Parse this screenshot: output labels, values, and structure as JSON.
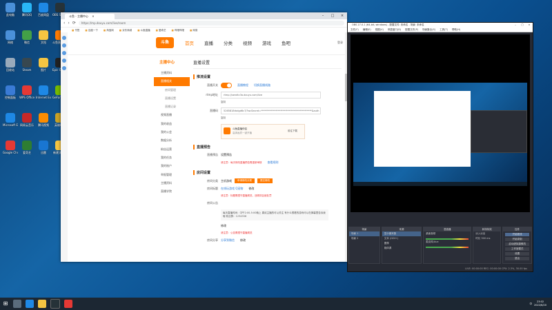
{
  "desktop": {
    "icons": [
      {
        "label": "此电脑",
        "color": "#4a90d9"
      },
      {
        "label": "网络",
        "color": "#4a90d9"
      },
      {
        "label": "回收站",
        "color": "#9ab"
      },
      {
        "label": "控制面板",
        "color": "#3a7bd5"
      },
      {
        "label": "Microsoft Edge",
        "color": "#1e88e5"
      },
      {
        "label": "Google Chrome",
        "color": "#e53935"
      },
      {
        "label": "腾讯QQ",
        "color": "#29b6f6"
      },
      {
        "label": "微信",
        "color": "#43a047"
      },
      {
        "label": "Steam",
        "color": "#37474f"
      },
      {
        "label": "WPS Office",
        "color": "#e53935"
      },
      {
        "label": "网易云音乐",
        "color": "#c62828"
      },
      {
        "label": "爱奇艺",
        "color": "#2e7d32"
      },
      {
        "label": "百度网盘",
        "color": "#1e88e5"
      },
      {
        "label": "文档",
        "color": "#f5c542"
      },
      {
        "label": "图片",
        "color": "#f5c542"
      },
      {
        "label": "Internet Explorer",
        "color": "#1e88e5"
      },
      {
        "label": "腾讯视频",
        "color": "#fb8c00"
      },
      {
        "label": "迅雷",
        "color": "#1976d2"
      },
      {
        "label": "OBS Studio",
        "color": "#263238"
      },
      {
        "label": "斗鱼直播伴侣",
        "color": "#ff7a00"
      },
      {
        "label": "Epic Games",
        "color": "#212121"
      },
      {
        "label": "GeForce Experience",
        "color": "#76b900"
      },
      {
        "label": "英雄联盟",
        "color": "#c9a227"
      },
      {
        "label": "新建文件夹",
        "color": "#f5c542"
      }
    ]
  },
  "browser": {
    "tab_title": "斗鱼 - 主播中心",
    "tab_close": "×",
    "url": "https://mp.douyu.com/live/room",
    "nav_back": "‹",
    "nav_forward": "›",
    "nav_reload": "⟳",
    "win_min": "–",
    "win_max": "□",
    "win_close": "×",
    "bookmarks": [
      "书签",
      "百度一下",
      "淘宝网",
      "京东商城",
      "斗鱼直播",
      "爱奇艺",
      "哔哩哔哩",
      "网易"
    ]
  },
  "site": {
    "logo": "斗鱼",
    "nav": [
      "首页",
      "直播",
      "分类",
      "视频",
      "游戏",
      "鱼吧"
    ],
    "login": "登录"
  },
  "sidebar": {
    "title": "主播中心",
    "items": [
      {
        "label": "主播资料",
        "active": false,
        "sub": false
      },
      {
        "label": "直播相关",
        "active": true,
        "sub": false
      },
      {
        "label": "房间管理",
        "active": false,
        "sub": true
      },
      {
        "label": "直播设置",
        "active": false,
        "sub": true
      },
      {
        "label": "直播记录",
        "active": false,
        "sub": true
      },
      {
        "label": "视频直播",
        "active": false,
        "sub": false
      },
      {
        "label": "我的收益",
        "active": false,
        "sub": false
      },
      {
        "label": "我的公会",
        "active": false,
        "sub": false
      },
      {
        "label": "数据分析",
        "active": false,
        "sub": false
      },
      {
        "label": "粉丝运营",
        "active": false,
        "sub": false
      },
      {
        "label": "我的任务",
        "active": false,
        "sub": false
      },
      {
        "label": "我的账户",
        "active": false,
        "sub": false
      },
      {
        "label": "举报管理",
        "active": false,
        "sub": false
      },
      {
        "label": "主播资料",
        "active": false,
        "sub": false
      },
      {
        "label": "直播学院",
        "active": false,
        "sub": false
      }
    ]
  },
  "main": {
    "page_title": "直播设置",
    "sec_push": "推流设置",
    "toggle_label": "直播开关",
    "toggle_link1": "直播教程",
    "toggle_link2": "切换直播线路",
    "rtmp_label": "rtmp地址",
    "rtmp_value": "rtmp://sendtc3a.douyu.com/live",
    "copy": "复制",
    "key_label": "直播码",
    "key_value": "5265818rbdgd6c7/?wcSecret=******************************************&auth",
    "copy2": "复制",
    "promo_title": "斗鱼直播伴侣",
    "promo_sub": "高清画质一键开播",
    "promo_btn": "前往下载",
    "sec_preview": "直播预告",
    "preview_label": "直播预告",
    "preview_value": "设置预告",
    "preview_red": "请注意：每次修改直播预告需重新审核",
    "preview_link": "查看规则",
    "sec_room": "房间设置",
    "room_label": "房间分类",
    "room_value": "主机游戏",
    "room_btn1": "申请修改分类",
    "room_btn2": "提交修改",
    "room_label2": "房间标题",
    "room_value2": "在线玩游戏 Q宠物",
    "room_edit": "修改",
    "room_red": "请注意：标题需遵守直播规范，违规将会被处罚",
    "notice_label": "房间公告",
    "notice_text": "每天直播时间：中午2:00-5:00晚上 喜欢主播的可以关注 有什么想看的游戏可以在弹幕里告诉我哦 粉丝群：1234558",
    "notice_edit": "修改",
    "notice_red": "请注意：公告需遵守直播规范",
    "footer_label": "房间分享",
    "footer_value": "分享到微信",
    "footer_edit": "修改"
  },
  "obs": {
    "title": "OBS 27.0.1 (64-bit, windows) - 配置文件: 未命名 - 场景: 未命名",
    "menu": [
      "文件(F)",
      "编辑(E)",
      "视图(V)",
      "停靠窗口(D)",
      "配置文件(P)",
      "场景集合(S)",
      "工具(T)",
      "帮助(H)"
    ],
    "docks": {
      "scenes": {
        "title": "场景",
        "items": [
          "场景 1",
          "场景 2"
        ]
      },
      "sources": {
        "title": "来源",
        "items": [
          "显示器采集",
          "文本 (GDI+)",
          "图像",
          "媒体源"
        ]
      },
      "mixer": {
        "title": "混音器",
        "items": [
          "桌面音频",
          "麦克风/Aux"
        ]
      },
      "transitions": {
        "title": "转场特效",
        "items": [
          "淡入淡出",
          "时长 300 ms"
        ]
      },
      "controls": {
        "title": "控件",
        "items": [
          "开始推流",
          "开始录制",
          "启动虚拟摄像机",
          "工作室模式",
          "设置",
          "退出"
        ]
      }
    },
    "status": "LIVE: 00:00:00   REC: 00:00:00   CPU: 2.3%, 30.00 fps"
  },
  "taskbar": {
    "start": "⊞",
    "tray_lang": "中",
    "time": "23:02",
    "date": "2022/6/20"
  },
  "colors": {
    "accent": "#ff7a00",
    "obs_bg": "#272a33",
    "taskbar": "#1c2733"
  }
}
